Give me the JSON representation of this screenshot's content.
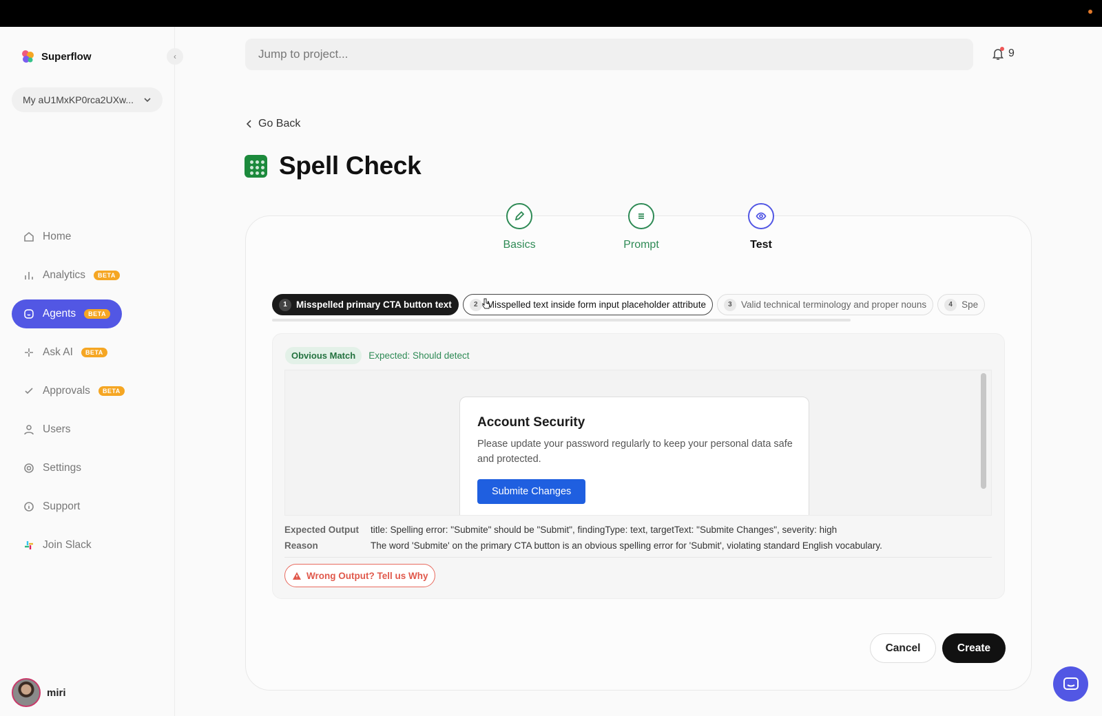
{
  "app": {
    "name": "Superflow"
  },
  "workspace": {
    "label": "My aU1MxKP0rca2UXw..."
  },
  "sidebar": {
    "items": [
      {
        "label": "Home",
        "icon": "home-icon",
        "beta": ""
      },
      {
        "label": "Analytics",
        "icon": "bar-chart-icon",
        "beta": "BETA"
      },
      {
        "label": "Agents",
        "icon": "agent-icon",
        "beta": "BETA"
      },
      {
        "label": "Ask AI",
        "icon": "sparkle-icon",
        "beta": "BETA"
      },
      {
        "label": "Approvals",
        "icon": "check-icon",
        "beta": "BETA"
      },
      {
        "label": "Users",
        "icon": "user-icon",
        "beta": ""
      },
      {
        "label": "Settings",
        "icon": "gear-icon",
        "beta": ""
      },
      {
        "label": "Support",
        "icon": "info-icon",
        "beta": ""
      },
      {
        "label": "Join Slack",
        "icon": "slack-icon",
        "beta": ""
      }
    ],
    "active": "Agents"
  },
  "user": {
    "name": "miri"
  },
  "search": {
    "placeholder": "Jump to project..."
  },
  "notifications": {
    "count": "9"
  },
  "page": {
    "back_label": "Go Back",
    "title": "Spell Check"
  },
  "steps": [
    {
      "label": "Basics",
      "icon": "pencil-icon"
    },
    {
      "label": "Prompt",
      "icon": "lines-icon"
    },
    {
      "label": "Test",
      "icon": "eye-icon"
    }
  ],
  "tabs": [
    {
      "num": "1",
      "label": "Misspelled primary CTA button text"
    },
    {
      "num": "2",
      "label": "Misspelled text inside form input placeholder attribute"
    },
    {
      "num": "3",
      "label": "Valid technical terminology and proper nouns"
    },
    {
      "num": "4",
      "label": "Spe"
    }
  ],
  "result": {
    "match_badge": "Obvious Match",
    "expected": "Expected: Should detect",
    "preview": {
      "heading": "Account Security",
      "body": "Please update your password regularly to keep your personal data safe and protected.",
      "button": "Submite Changes"
    },
    "expected_output_label": "Expected Output",
    "expected_output": "title: Spelling error: \"Submite\" should be \"Submit\", findingType: text, targetText: \"Submite Changes\", severity: high",
    "reason_label": "Reason",
    "reason": "The word 'Submite' on the primary CTA button is an obvious spelling error for 'Submit', violating standard English vocabulary.",
    "wrong_button": "Wrong Output? Tell us Why"
  },
  "footer": {
    "cancel": "Cancel",
    "create": "Create"
  },
  "colors": {
    "accent": "#5257e4",
    "success": "#2e8a55",
    "beta": "#f5a623",
    "danger": "#e0584b",
    "cta_blue": "#1f5fe0"
  }
}
